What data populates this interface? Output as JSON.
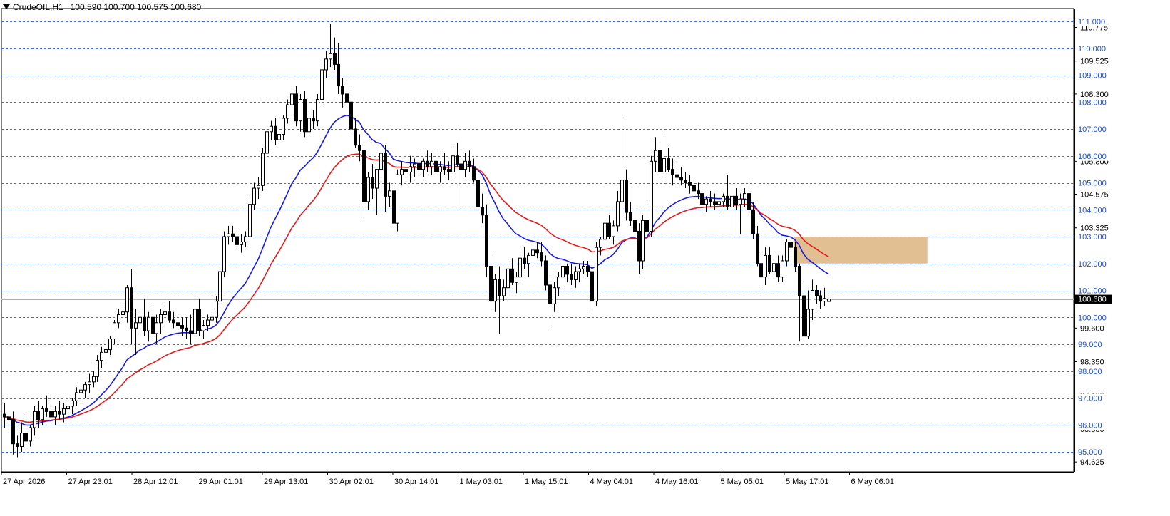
{
  "header": {
    "symbol": "CrudeOIL,H1",
    "ohlc": "100.590 100.700 100.575 100.680"
  },
  "colors": {
    "grid_level": "#3b6ee0",
    "ema_fast": "#1a1ae6",
    "ema_slow": "#e61a1a",
    "zone": "#deb887",
    "label_bg": "#ffffff",
    "label_text": "#1a4fd0",
    "price_tag_bg": "#000000",
    "price_tag_text": "#ffffff"
  },
  "chart_data": {
    "type": "candlestick",
    "symbol": "CrudeOIL",
    "timeframe": "H1",
    "ylim": [
      94.4,
      111.2
    ],
    "current_price": 100.68,
    "current_price_label": "100.680",
    "horizontal_levels": [
      111,
      110,
      109,
      108,
      107,
      106,
      105,
      104,
      103,
      102,
      101,
      100,
      99,
      98,
      97,
      96,
      95
    ],
    "level_labels": [
      "111.000",
      "110.000",
      "109.000",
      "108.000",
      "107.000",
      "106.000",
      "105.000",
      "104.000",
      "103.000",
      "102.000",
      "101.000",
      "100.000",
      "99.000",
      "98.000",
      "97.000",
      "96.000",
      "95.000"
    ],
    "axis_ticks": [
      {
        "v": 110.775,
        "label": "110.775"
      },
      {
        "v": 109.525,
        "label": "109.525"
      },
      {
        "v": 108.3,
        "label": "108.300"
      },
      {
        "v": 105.8,
        "label": "105.800"
      },
      {
        "v": 104.575,
        "label": "104.575"
      },
      {
        "v": 103.325,
        "label": "103.325"
      },
      {
        "v": 102.075,
        "label": "102.075"
      },
      {
        "v": 99.6,
        "label": "99.600"
      },
      {
        "v": 98.35,
        "label": "98.350"
      },
      {
        "v": 97.1,
        "label": "97.100"
      },
      {
        "v": 95.85,
        "label": "95.850"
      },
      {
        "v": 94.625,
        "label": "94.625"
      }
    ],
    "x_labels": [
      "27 Apr 2026",
      "27 Apr 23:01",
      "28 Apr 12:01",
      "29 Apr 01:01",
      "29 Apr 13:01",
      "30 Apr 02:01",
      "30 Apr 14:01",
      "1 May 03:01",
      "1 May 15:01",
      "4 May 04:01",
      "4 May 16:01",
      "5 May 05:01",
      "5 May 17:01",
      "6 May 06:01"
    ],
    "zone": {
      "from": 102.0,
      "to": 103.0,
      "start_index": 187,
      "end_index": 218
    },
    "candles": [
      [
        96.4,
        96.8,
        95.9,
        96.3
      ],
      [
        96.3,
        96.5,
        95.7,
        96.2
      ],
      [
        96.2,
        96.5,
        94.9,
        95.3
      ],
      [
        95.3,
        95.6,
        94.8,
        95.2
      ],
      [
        95.2,
        96.1,
        95.0,
        95.7
      ],
      [
        95.7,
        96.4,
        94.9,
        95.4
      ],
      [
        95.4,
        96.0,
        95.2,
        95.9
      ],
      [
        95.9,
        96.7,
        95.6,
        96.5
      ],
      [
        96.5,
        96.9,
        95.9,
        96.2
      ],
      [
        96.2,
        96.7,
        96.0,
        96.6
      ],
      [
        96.6,
        97.1,
        96.3,
        96.5
      ],
      [
        96.5,
        96.9,
        96.0,
        96.3
      ],
      [
        96.3,
        96.7,
        96.0,
        96.5
      ],
      [
        96.5,
        96.9,
        96.2,
        96.4
      ],
      [
        96.4,
        96.8,
        96.1,
        96.6
      ],
      [
        96.6,
        97.0,
        96.3,
        96.7
      ],
      [
        96.7,
        97.0,
        96.4,
        96.9
      ],
      [
        96.9,
        97.4,
        96.7,
        97.2
      ],
      [
        97.2,
        97.5,
        96.9,
        97.3
      ],
      [
        97.3,
        97.6,
        97.0,
        97.5
      ],
      [
        97.5,
        97.9,
        97.2,
        97.6
      ],
      [
        97.6,
        98.0,
        97.4,
        97.8
      ],
      [
        97.8,
        98.6,
        97.6,
        98.4
      ],
      [
        98.4,
        98.9,
        98.1,
        98.7
      ],
      [
        98.7,
        99.1,
        98.3,
        98.8
      ],
      [
        98.8,
        99.3,
        98.6,
        99.2
      ],
      [
        99.2,
        99.9,
        99.0,
        99.8
      ],
      [
        99.8,
        100.3,
        99.6,
        100.1
      ],
      [
        100.1,
        100.5,
        99.9,
        100.2
      ],
      [
        100.2,
        101.2,
        99.8,
        101.1
      ],
      [
        101.1,
        101.8,
        99.0,
        99.6
      ],
      [
        99.6,
        100.3,
        98.6,
        99.8
      ],
      [
        99.8,
        100.2,
        99.4,
        100.0
      ],
      [
        100.0,
        100.7,
        99.3,
        99.5
      ],
      [
        99.5,
        100.2,
        99.1,
        100.0
      ],
      [
        100.0,
        100.5,
        99.2,
        99.4
      ],
      [
        99.4,
        100.1,
        99.0,
        99.8
      ],
      [
        99.8,
        100.3,
        99.4,
        100.1
      ],
      [
        100.1,
        100.4,
        99.7,
        100.2
      ],
      [
        100.2,
        100.6,
        99.8,
        99.9
      ],
      [
        99.9,
        100.2,
        99.6,
        99.8
      ],
      [
        99.8,
        100.1,
        99.5,
        99.7
      ],
      [
        99.7,
        100.0,
        99.3,
        99.6
      ],
      [
        99.6,
        100.0,
        99.2,
        99.5
      ],
      [
        99.5,
        100.1,
        99.0,
        99.4
      ],
      [
        99.4,
        100.6,
        99.2,
        100.3
      ],
      [
        100.3,
        100.7,
        99.3,
        99.5
      ],
      [
        99.5,
        99.9,
        99.2,
        99.7
      ],
      [
        99.7,
        100.1,
        99.5,
        99.9
      ],
      [
        99.9,
        100.3,
        99.7,
        100.0
      ],
      [
        100.0,
        100.8,
        99.8,
        100.6
      ],
      [
        100.6,
        101.8,
        100.4,
        101.7
      ],
      [
        101.7,
        103.2,
        101.5,
        103.0
      ],
      [
        103.0,
        103.4,
        102.7,
        103.1
      ],
      [
        103.1,
        103.4,
        102.8,
        103.0
      ],
      [
        103.0,
        103.3,
        102.5,
        102.7
      ],
      [
        102.7,
        103.1,
        102.4,
        102.8
      ],
      [
        102.8,
        103.2,
        102.6,
        103.0
      ],
      [
        103.0,
        104.4,
        102.8,
        104.2
      ],
      [
        104.2,
        105.0,
        104.0,
        104.8
      ],
      [
        104.8,
        105.2,
        104.4,
        104.9
      ],
      [
        104.9,
        106.3,
        104.7,
        106.1
      ],
      [
        106.1,
        107.1,
        106.0,
        106.9
      ],
      [
        106.9,
        107.3,
        106.6,
        107.1
      ],
      [
        107.1,
        107.4,
        106.4,
        106.6
      ],
      [
        106.6,
        107.0,
        106.3,
        106.8
      ],
      [
        106.8,
        107.5,
        106.6,
        107.4
      ],
      [
        107.4,
        108.1,
        107.2,
        107.9
      ],
      [
        107.9,
        108.4,
        107.5,
        108.3
      ],
      [
        108.3,
        108.6,
        107.1,
        107.3
      ],
      [
        107.3,
        108.3,
        106.9,
        108.1
      ],
      [
        108.1,
        108.4,
        106.7,
        106.9
      ],
      [
        106.9,
        107.6,
        106.8,
        107.4
      ],
      [
        107.4,
        107.7,
        107.0,
        107.3
      ],
      [
        107.3,
        108.3,
        107.1,
        108.1
      ],
      [
        108.1,
        109.4,
        107.9,
        109.2
      ],
      [
        109.2,
        109.9,
        108.9,
        109.6
      ],
      [
        109.6,
        110.9,
        109.3,
        109.8
      ],
      [
        109.8,
        110.4,
        109.2,
        109.4
      ],
      [
        109.4,
        110.2,
        108.3,
        108.6
      ],
      [
        108.6,
        108.9,
        107.8,
        108.3
      ],
      [
        108.3,
        108.8,
        107.9,
        108.0
      ],
      [
        108.0,
        108.6,
        106.9,
        107.0
      ],
      [
        107.0,
        107.4,
        106.3,
        106.4
      ],
      [
        106.4,
        106.8,
        105.8,
        106.2
      ],
      [
        106.2,
        106.5,
        103.6,
        104.3
      ],
      [
        104.3,
        105.4,
        104.0,
        105.2
      ],
      [
        105.2,
        105.7,
        104.4,
        104.8
      ],
      [
        104.8,
        105.3,
        103.8,
        105.5
      ],
      [
        105.5,
        106.3,
        105.1,
        106.1
      ],
      [
        106.1,
        106.4,
        103.9,
        104.5
      ],
      [
        104.5,
        105.0,
        104.1,
        104.7
      ],
      [
        104.7,
        105.0,
        103.4,
        103.5
      ],
      [
        103.5,
        105.5,
        103.2,
        105.3
      ],
      [
        105.3,
        105.8,
        104.9,
        105.5
      ],
      [
        105.5,
        105.8,
        105.1,
        105.4
      ],
      [
        105.4,
        106.0,
        105.0,
        105.6
      ],
      [
        105.6,
        105.9,
        105.2,
        105.7
      ],
      [
        105.7,
        106.2,
        105.3,
        105.5
      ],
      [
        105.5,
        105.9,
        105.2,
        105.8
      ],
      [
        105.8,
        106.2,
        105.4,
        105.6
      ],
      [
        105.6,
        106.1,
        105.3,
        105.8
      ],
      [
        105.8,
        106.2,
        105.5,
        105.4
      ],
      [
        105.4,
        105.8,
        105.0,
        105.6
      ],
      [
        105.6,
        106.1,
        105.3,
        105.5
      ],
      [
        105.5,
        105.8,
        105.1,
        105.4
      ],
      [
        105.4,
        106.3,
        105.2,
        106.0
      ],
      [
        106.0,
        106.5,
        105.6,
        105.7
      ],
      [
        105.7,
        106.2,
        104.0,
        105.5
      ],
      [
        105.5,
        106.1,
        105.2,
        105.8
      ],
      [
        105.8,
        106.2,
        105.4,
        105.6
      ],
      [
        105.6,
        105.9,
        105.0,
        105.1
      ],
      [
        105.1,
        105.4,
        104.0,
        104.1
      ],
      [
        104.1,
        104.6,
        103.5,
        103.8
      ],
      [
        103.8,
        104.2,
        101.5,
        101.9
      ],
      [
        101.9,
        102.3,
        100.3,
        100.6
      ],
      [
        100.6,
        101.6,
        100.2,
        101.4
      ],
      [
        101.4,
        101.9,
        99.4,
        100.8
      ],
      [
        100.8,
        101.4,
        100.6,
        101.1
      ],
      [
        101.1,
        102.2,
        100.9,
        101.8
      ],
      [
        101.8,
        102.2,
        101.2,
        101.3
      ],
      [
        101.3,
        101.7,
        100.9,
        101.5
      ],
      [
        101.5,
        102.4,
        101.3,
        102.2
      ],
      [
        102.2,
        102.6,
        101.8,
        102.0
      ],
      [
        102.0,
        102.4,
        101.5,
        102.3
      ],
      [
        102.3,
        102.7,
        101.9,
        102.5
      ],
      [
        102.5,
        102.8,
        102.2,
        102.4
      ],
      [
        102.4,
        102.8,
        101.9,
        102.1
      ],
      [
        102.1,
        102.3,
        101.0,
        101.2
      ],
      [
        101.2,
        101.5,
        99.6,
        100.5
      ],
      [
        100.5,
        101.3,
        100.2,
        101.1
      ],
      [
        101.1,
        101.7,
        100.8,
        101.5
      ],
      [
        101.5,
        102.1,
        101.1,
        101.9
      ],
      [
        101.9,
        102.0,
        101.3,
        101.6
      ],
      [
        101.6,
        102.0,
        101.2,
        101.4
      ],
      [
        101.4,
        101.9,
        101.1,
        101.7
      ],
      [
        101.7,
        102.0,
        101.3,
        101.8
      ],
      [
        101.8,
        102.1,
        101.6,
        101.9
      ],
      [
        101.9,
        102.1,
        101.5,
        101.7
      ],
      [
        101.7,
        102.1,
        100.2,
        100.6
      ],
      [
        100.6,
        102.8,
        100.4,
        102.6
      ],
      [
        102.6,
        103.0,
        102.3,
        102.9
      ],
      [
        102.9,
        103.7,
        102.6,
        103.5
      ],
      [
        103.5,
        103.8,
        102.9,
        103.0
      ],
      [
        103.0,
        103.6,
        102.7,
        103.4
      ],
      [
        103.4,
        104.7,
        103.2,
        104.3
      ],
      [
        104.3,
        107.5,
        104.0,
        105.1
      ],
      [
        105.1,
        105.5,
        103.6,
        103.9
      ],
      [
        103.9,
        104.3,
        103.4,
        103.6
      ],
      [
        103.6,
        104.1,
        102.8,
        103.2
      ],
      [
        103.2,
        103.5,
        101.6,
        102.1
      ],
      [
        102.1,
        103.8,
        101.8,
        103.6
      ],
      [
        103.6,
        104.3,
        102.9,
        103.2
      ],
      [
        103.2,
        106.0,
        103.0,
        105.8
      ],
      [
        105.8,
        106.7,
        105.4,
        106.2
      ],
      [
        106.2,
        106.5,
        105.2,
        105.4
      ],
      [
        105.4,
        106.8,
        105.1,
        105.9
      ],
      [
        105.9,
        106.3,
        105.4,
        105.5
      ],
      [
        105.5,
        105.9,
        104.9,
        105.3
      ],
      [
        105.3,
        105.7,
        104.9,
        105.2
      ],
      [
        105.2,
        105.6,
        104.9,
        105.1
      ],
      [
        105.1,
        105.4,
        104.8,
        105.0
      ],
      [
        105.0,
        105.3,
        104.6,
        104.9
      ],
      [
        104.9,
        105.2,
        104.5,
        104.7
      ],
      [
        104.7,
        105.0,
        104.4,
        104.6
      ],
      [
        104.6,
        104.9,
        103.9,
        104.2
      ],
      [
        104.2,
        104.5,
        103.9,
        104.4
      ],
      [
        104.4,
        104.7,
        104.1,
        104.3
      ],
      [
        104.3,
        104.6,
        104.0,
        104.2
      ],
      [
        104.2,
        104.5,
        103.9,
        104.3
      ],
      [
        104.3,
        104.6,
        104.1,
        104.5
      ],
      [
        104.5,
        105.3,
        104.0,
        104.1
      ],
      [
        104.1,
        104.9,
        103.0,
        104.5
      ],
      [
        104.5,
        104.8,
        104.0,
        104.2
      ],
      [
        104.2,
        104.6,
        103.1,
        104.4
      ],
      [
        104.4,
        104.8,
        104.1,
        104.6
      ],
      [
        104.6,
        105.1,
        103.9,
        104.0
      ],
      [
        104.0,
        104.3,
        102.9,
        103.1
      ],
      [
        103.1,
        103.4,
        101.9,
        102.0
      ],
      [
        102.0,
        102.4,
        101.0,
        101.5
      ],
      [
        101.5,
        102.6,
        101.2,
        102.3
      ],
      [
        102.3,
        102.6,
        101.6,
        101.7
      ],
      [
        101.7,
        102.2,
        101.5,
        102.0
      ],
      [
        102.0,
        102.3,
        101.3,
        101.5
      ],
      [
        101.5,
        102.3,
        101.3,
        102.1
      ],
      [
        102.1,
        102.9,
        101.9,
        102.8
      ],
      [
        102.8,
        103.0,
        102.4,
        102.6
      ],
      [
        102.6,
        102.8,
        101.7,
        101.9
      ],
      [
        101.9,
        102.0,
        99.1,
        100.8
      ],
      [
        100.8,
        101.3,
        99.1,
        99.3
      ],
      [
        99.3,
        101.0,
        99.2,
        100.3
      ],
      [
        100.3,
        101.4,
        99.9,
        101.0
      ],
      [
        101.0,
        101.2,
        100.5,
        100.8
      ],
      [
        100.8,
        101.0,
        100.3,
        100.6
      ],
      [
        100.6,
        101.1,
        100.4,
        100.7
      ],
      [
        100.59,
        100.7,
        100.575,
        100.68
      ]
    ]
  }
}
